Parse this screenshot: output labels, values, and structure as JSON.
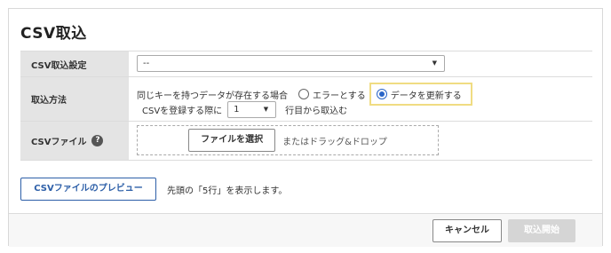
{
  "page_title": "CSV取込",
  "settings": {
    "label": "CSV取込設定",
    "select_value": "--"
  },
  "import_method": {
    "label": "取込方法",
    "duplicate_prompt": "同じキーを持つデータが存在する場合",
    "option_error": "エラーとする",
    "option_update": "データを更新する",
    "selected_option": "update",
    "start_row_prefix": "CSVを登録する際に",
    "start_row_value": "1",
    "start_row_suffix": "行目から取込む"
  },
  "csv_file": {
    "label": "CSVファイル",
    "help_icon": "?",
    "choose_button": "ファイルを選択",
    "drop_hint": "またはドラッグ&ドロップ"
  },
  "preview": {
    "button": "CSVファイルのプレビュー",
    "note": "先頭の「5行」を表示します。"
  },
  "footer": {
    "cancel_button": "キャンセル",
    "start_button": "取込開始"
  },
  "colors": {
    "accent": "#2d5fa8",
    "highlight_border": "#f0dc82",
    "label_bg": "#e4e4e4",
    "disabled_button": "#d5d5d5"
  }
}
